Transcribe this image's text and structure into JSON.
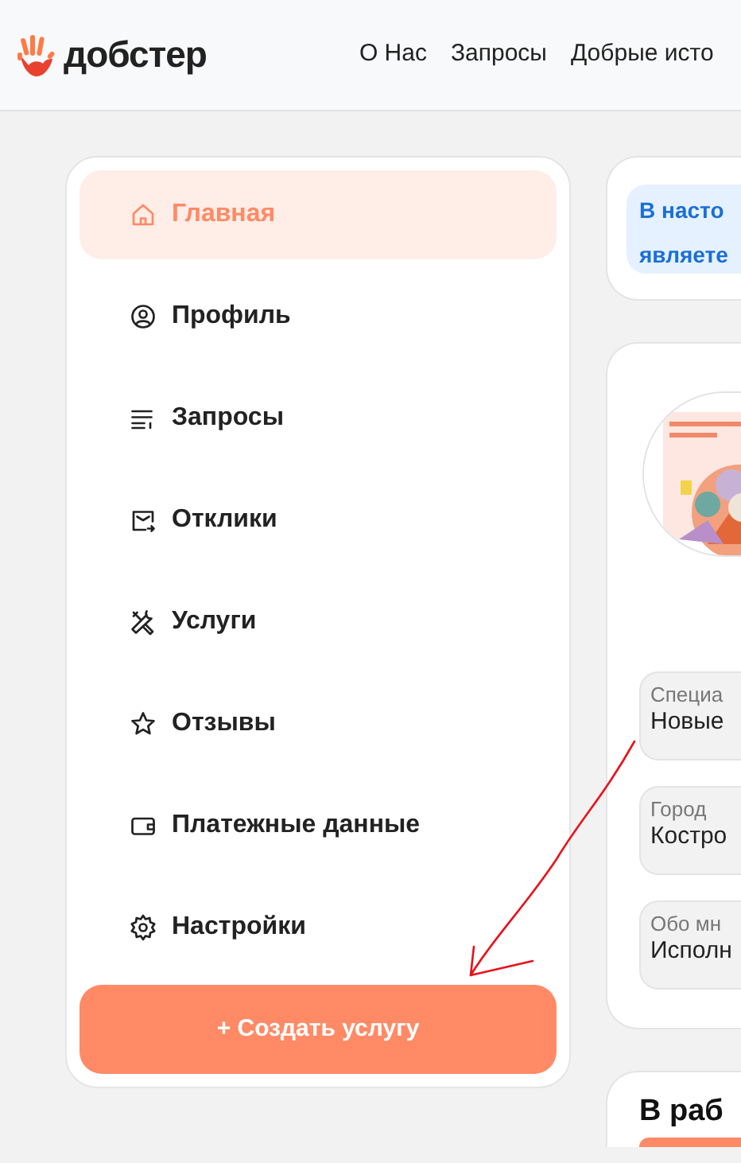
{
  "header": {
    "logo": "добстер",
    "nav": [
      {
        "label": "О Нас"
      },
      {
        "label": "Запросы"
      },
      {
        "label": "Добрые исто"
      }
    ]
  },
  "sidebar": {
    "items": [
      {
        "label": "Главная",
        "selected": true
      },
      {
        "label": "Профиль",
        "selected": false
      },
      {
        "label": "Запросы",
        "selected": false
      },
      {
        "label": "Отклики",
        "selected": false
      },
      {
        "label": "Услуги",
        "selected": false
      },
      {
        "label": "Отзывы",
        "selected": false
      },
      {
        "label": "Платежные данные",
        "selected": false
      },
      {
        "label": "Настройки",
        "selected": false
      }
    ],
    "button": "+ Создать услугу"
  },
  "notice": {
    "lines": [
      "В насто",
      "являете"
    ]
  },
  "profile": {
    "fields": [
      {
        "label": "Специа",
        "value": "Новые"
      },
      {
        "label": "Город",
        "value": "Костро"
      },
      {
        "label": "Обо мн",
        "value": "Исполн"
      }
    ]
  },
  "work": {
    "title": "В раб"
  }
}
